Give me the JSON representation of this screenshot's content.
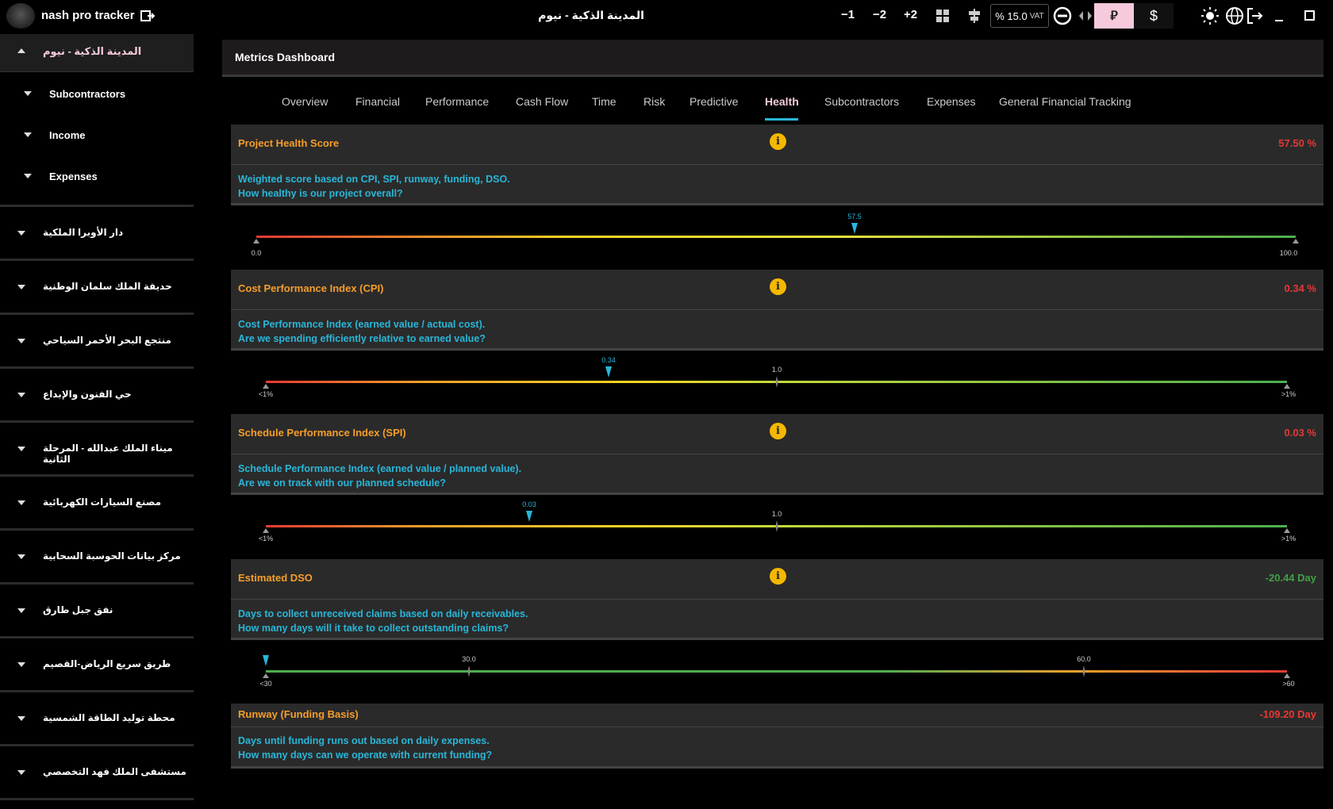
{
  "topbar": {
    "app_title": "nash pro tracker",
    "center_title": "المدينة الذكية - نيوم",
    "buttons": [
      "−1",
      "−2",
      "+2"
    ],
    "vat_percent": "% 15.0",
    "vat_label": "VAT",
    "currency_riyal": "⃁",
    "currency_usd": "$"
  },
  "sidebar": {
    "active_project": "المدينة الذكية - نيوم",
    "sub_items": [
      "Subcontractors",
      "Income",
      "Expenses"
    ],
    "projects": [
      "دار الأوبرا الملكية",
      "حديقة الملك سلمان الوطنية",
      "منتجع البحر الأحمر السياحي",
      "حي الفنون والإبداع",
      "ميناء الملك عبدالله - المرحلة الثانية",
      "مصنع السيارات الكهربائية",
      "مركز بيانات الحوسبة السحابية",
      "نفق جبل طارق",
      "طريق سريع الرياض-القصيم",
      "محطة توليد الطاقة الشمسية",
      "مستشفى الملك فهد التخصصي"
    ]
  },
  "main": {
    "header_title": "Metrics Dashboard",
    "tabs": [
      "Overview",
      "Financial",
      "Performance",
      "Cash Flow",
      "Time",
      "Risk",
      "Predictive",
      "Health",
      "Subcontractors",
      "Expenses",
      "General Financial Tracking"
    ],
    "active_tab": "Health",
    "metrics": [
      {
        "title": "Project Health Score",
        "value": "57.50 %",
        "value_color": "#e53935",
        "line1": "Weighted score based on CPI, SPI, runway, funding, DSO.",
        "line2": "How healthy is our project overall?",
        "gauge": {
          "pointer_label": "57.5",
          "pointer_value": 57.5,
          "min_label": "0.0",
          "max_label": "100.0",
          "min": 0,
          "max": 100,
          "scheme": "red-yellow-green"
        }
      },
      {
        "title": "Cost Performance Index (CPI)",
        "value": "0.34 %",
        "value_color": "#e53935",
        "line1": "Cost Performance Index (earned value / actual cost).",
        "line2": "Are we spending efficiently relative to earned value?",
        "gauge": {
          "pointer_label": "0.34",
          "pointer_value": 0.34,
          "min_label": "<1%",
          "max_label": ">1%",
          "mid_label": "1.0",
          "min": 0,
          "max": 2,
          "scheme": "red-yellow-green"
        }
      },
      {
        "title": "Schedule Performance Index (SPI)",
        "value": "0.03 %",
        "value_color": "#e53935",
        "line1": "Schedule Performance Index (earned value / planned value).",
        "line2": "Are we on track with our planned schedule?",
        "gauge": {
          "pointer_label": "0.03",
          "pointer_value": 0.03,
          "min_label": "<1%",
          "max_label": ">1%",
          "mid_label": "1.0",
          "min": 0,
          "max": 2,
          "scheme": "red-yellow-green"
        }
      },
      {
        "title": "Estimated DSO",
        "value": "-20.44 Day",
        "value_color": "#43a047",
        "line1": "Days to collect unreceived claims based on daily receivables.",
        "line2": "How many days will it take to collect outstanding claims?",
        "gauge": {
          "pointer_label": "",
          "pointer_value": 0,
          "min_label": "<30",
          "max_label": ">60",
          "tick1_label": "30.0",
          "tick2_label": "60.0",
          "scheme": "green-red"
        }
      },
      {
        "title": "Runway (Funding Basis)",
        "value": "-109.20 Day",
        "value_color": "#e53935",
        "line1": "Days until funding runs out based on daily expenses.",
        "line2": "How many days can we operate with current funding?"
      }
    ]
  }
}
